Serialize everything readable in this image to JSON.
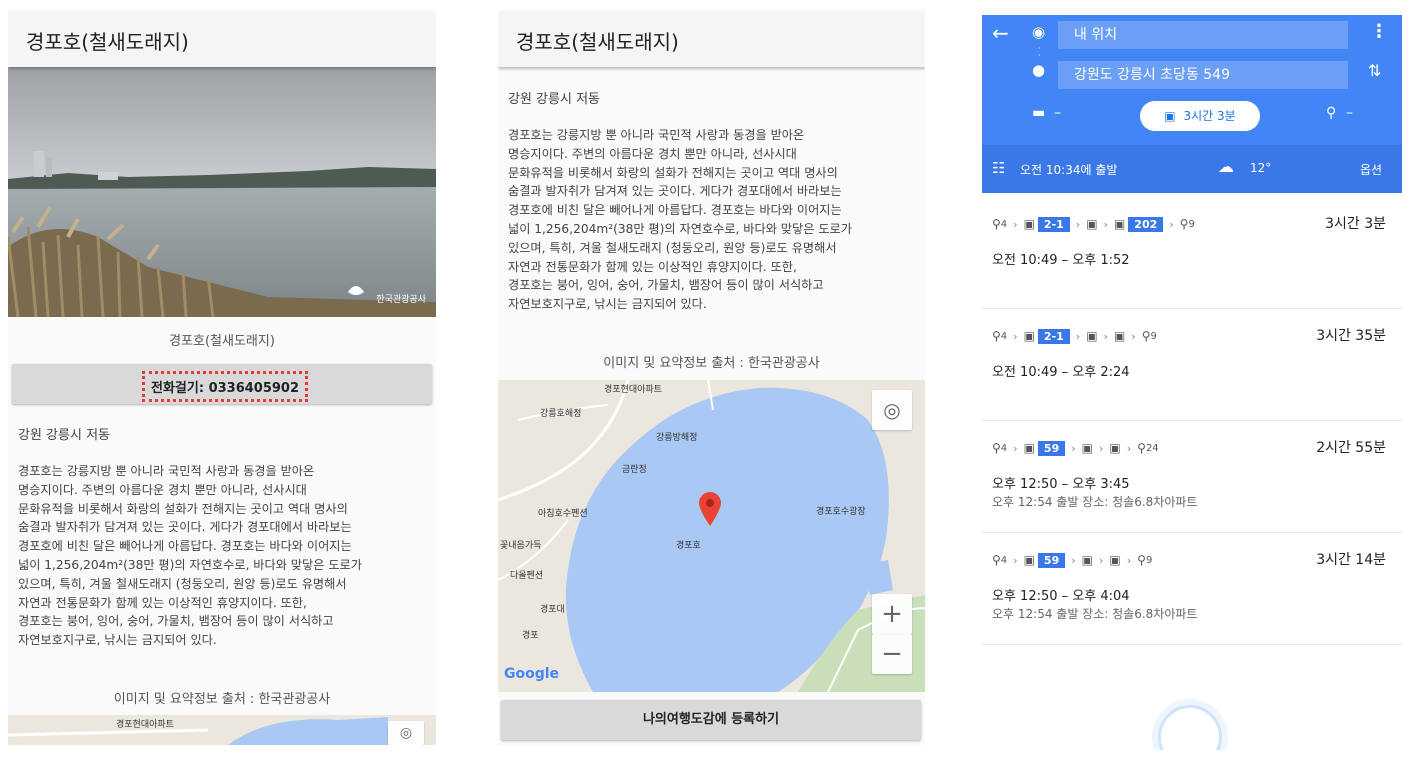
{
  "screen1": {
    "title": "경포호(철새도래지)",
    "watermark": "한국관광공사",
    "photo_caption": "경포호(철새도래지)",
    "call_button": "전화걸기: 0336405902",
    "address": "강원 강릉시 저동",
    "description": "경포호는 강릉지방 뿐 아니라 국민적 사랑과 동경을 받아온\n명승지이다. 주변의 아름다운 경치 뿐만 아니라, 선사시대\n문화유적을 비롯해서 화랑의 설화가 전해지는 곳이고 역대 명사의\n숨결과 발자취가 담겨져 있는 곳이다. 게다가 경포대에서 바라보는\n경포호에 비친 달은 빼어나게 아름답다. 경포호는 바다와 이어지는\n넓이 1,256,204m²(38만 평)의 자연호수로, 바다와 맞닿은 도로가\n있으며, 특히, 겨울 철새도래지 (청둥오리, 원앙 등)로도 유명해서\n자연과 전통문화가 함께 있는 이상적인 휴양지이다. 또한,\n경포호는 붕어, 잉어, 숭어, 가물치, 뱀장어 등이 많이 서식하고\n자연보호지구로, 낚시는 금지되어 있다.",
    "source": "이미지 및 요약정보 출처 : 한국관광공사",
    "map_label": "경포현대아파트"
  },
  "screen2": {
    "title": "경포호(철새도래지)",
    "address": "강원 강릉시 저동",
    "description": "경포호는 강릉지방 뿐 아니라 국민적 사랑과 동경을 받아온\n명승지이다. 주변의 아름다운 경치 뿐만 아니라, 선사시대\n문화유적을 비롯해서 화랑의 설화가 전해지는 곳이고 역대 명사의\n숨결과 발자취가 담겨져 있는 곳이다. 게다가 경포대에서 바라보는\n경포호에 비친 달은 빼어나게 아름답다. 경포호는 바다와 이어지는\n넓이 1,256,204m²(38만 평)의 자연호수로, 바다와 맞닿은 도로가\n있으며, 특히, 겨울 철새도래지 (청둥오리, 원앙 등)로도 유명해서\n자연과 전통문화가 함께 있는 이상적인 휴양지이다. 또한,\n경포호는 붕어, 잉어, 숭어, 가물치, 뱀장어 등이 많이 서식하고\n자연보호지구로, 낚시는 금지되어 있다.",
    "source": "이미지 및 요약정보 출처 : 한국관광공사",
    "map": {
      "labels": [
        "경포현대아파트",
        "강릉호해정",
        "강릉방해정",
        "금란정",
        "아침호수펜션",
        "꽃내음가득",
        "다올펜션",
        "경포대",
        "경포",
        "경포호",
        "경포호수광장"
      ],
      "zoom_in": "+",
      "zoom_out": "−",
      "logo": "Google"
    },
    "register_button": "나의여행도감에 등록하기"
  },
  "screen3": {
    "origin": "내 위치",
    "destination": "강원도 강릉시 초당동 549",
    "car_mode": "–",
    "transit_mode": "3시간 3분",
    "walk_mode": "–",
    "depart": "오전 10:34에 출발",
    "weather": "12°",
    "options": "옵션",
    "routes": [
      {
        "walk_start": "4",
        "buses": [
          "2-1",
          "",
          "202"
        ],
        "walk_end": "9",
        "duration": "3시간 3분",
        "time": "오전 10:49 – 오후 1:52",
        "note": ""
      },
      {
        "walk_start": "4",
        "buses": [
          "2-1",
          "",
          ""
        ],
        "walk_end": "9",
        "duration": "3시간 35분",
        "time": "오전 10:49 – 오후 2:24",
        "note": ""
      },
      {
        "walk_start": "4",
        "buses": [
          "59",
          "",
          ""
        ],
        "walk_end": "24",
        "duration": "2시간 55분",
        "time": "오후 12:50 – 오후 3:45",
        "note": "오후 12:54 출발 장소: 청솔6.8차아파트"
      },
      {
        "walk_start": "4",
        "buses": [
          "59",
          "",
          ""
        ],
        "walk_end": "9",
        "duration": "3시간 14분",
        "time": "오후 12:50 – 오후 4:04",
        "note": "오후 12:54 출발 장소: 청솔6.8차아파트"
      }
    ],
    "colors": {
      "header": "#4285f4",
      "accent": "#1a73e8"
    }
  }
}
